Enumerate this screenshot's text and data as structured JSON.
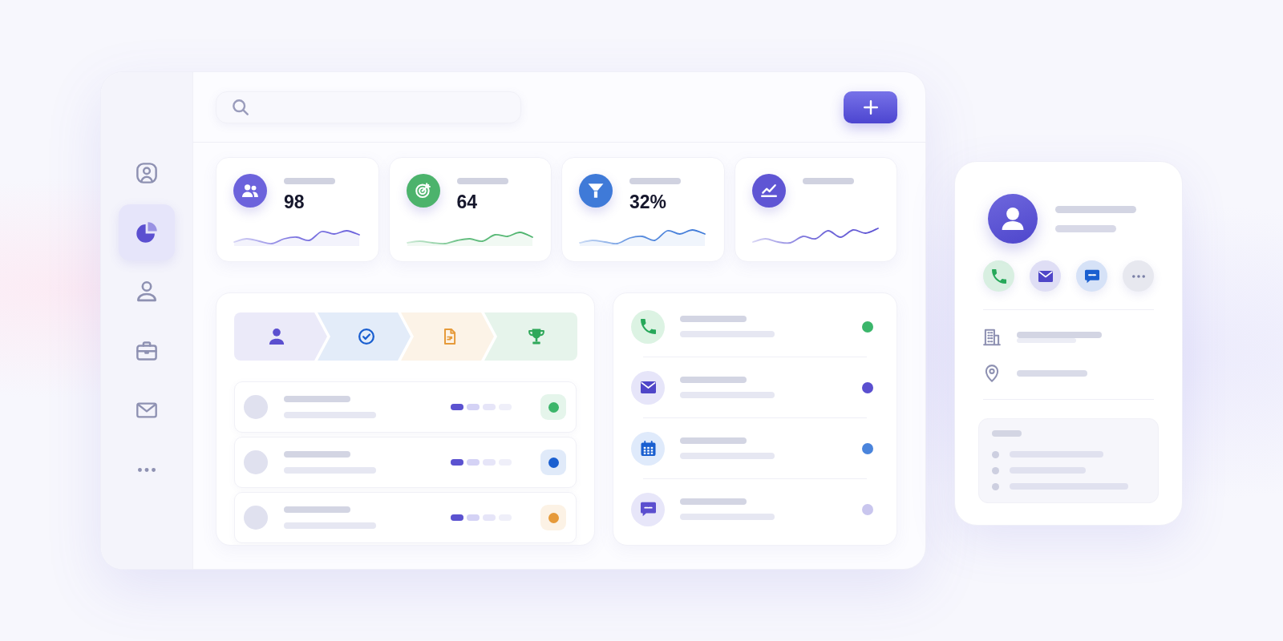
{
  "sidebar": {
    "items": [
      {
        "selected": false
      },
      {
        "selected": true
      },
      {
        "selected": false
      },
      {
        "selected": false
      },
      {
        "selected": false
      },
      {
        "selected": false
      }
    ]
  },
  "stat_cards": [
    {
      "value": "98",
      "color": "#6c63dc"
    },
    {
      "value": "64",
      "color": "#4cb36c"
    },
    {
      "value": "32%",
      "color": "#3f7ad8"
    },
    {
      "color": "#5f55d4"
    }
  ],
  "pipeline": {
    "stages": [
      {
        "color": "#5b4fcf"
      },
      {
        "color": "#1a5fd0"
      },
      {
        "color": "#e69a3a"
      },
      {
        "color": "#2fa85a"
      }
    ]
  },
  "deals": [
    {
      "level": 0.25,
      "color": "#3cb56a"
    },
    {
      "level": 0.25,
      "color": "#1a5fd0"
    },
    {
      "level": 0.25,
      "color": "#e69a3a"
    }
  ],
  "activities": [
    {
      "color": "#3bb66b"
    },
    {
      "color": "#5a4fcf"
    },
    {
      "color": "#4a84dc"
    },
    {
      "color": "#c9c6ee"
    }
  ],
  "contact_card": {
    "actions": [
      {
        "color": "#27a85a"
      },
      {
        "color": "#4f46c8"
      },
      {
        "color": "#1a5fd0"
      },
      {
        "color": "#7a7fa6"
      }
    ]
  }
}
